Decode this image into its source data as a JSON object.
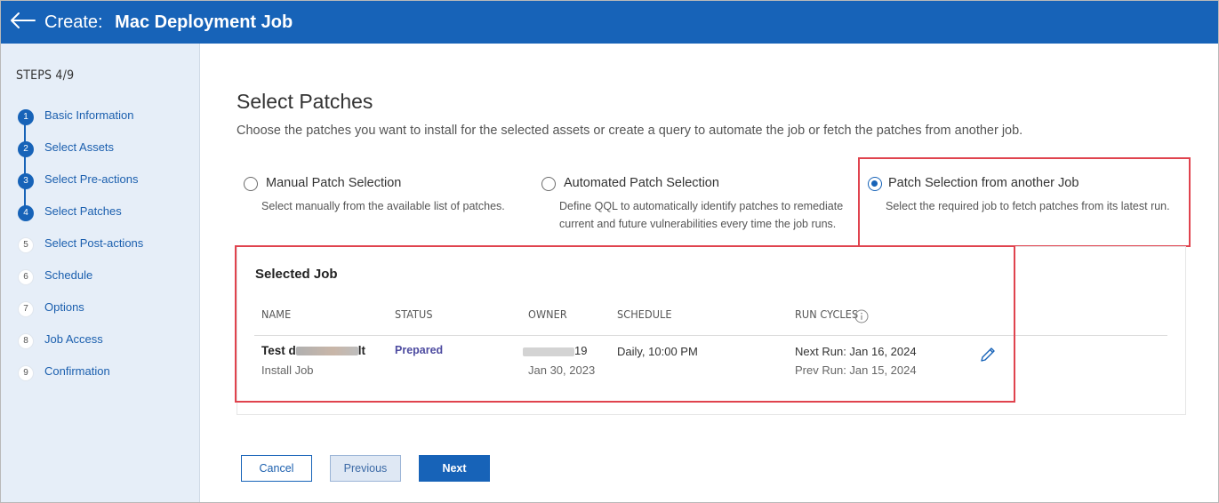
{
  "header": {
    "prefix": "Create:",
    "title": "Mac Deployment Job"
  },
  "sidebar": {
    "steps_label": "STEPS 4/9",
    "items": [
      {
        "num": "1",
        "label": "Basic Information"
      },
      {
        "num": "2",
        "label": "Select Assets"
      },
      {
        "num": "3",
        "label": "Select Pre-actions"
      },
      {
        "num": "4",
        "label": "Select Patches"
      },
      {
        "num": "5",
        "label": "Select Post-actions"
      },
      {
        "num": "6",
        "label": "Schedule"
      },
      {
        "num": "7",
        "label": "Options"
      },
      {
        "num": "8",
        "label": "Job Access"
      },
      {
        "num": "9",
        "label": "Confirmation"
      }
    ]
  },
  "main": {
    "title": "Select Patches",
    "description": "Choose the patches you want to install for the selected assets or create a query to automate the job or fetch the patches from another job.",
    "options": [
      {
        "title": "Manual Patch Selection",
        "desc_lines": [
          "Select manually from the available list of patches."
        ],
        "selected": false
      },
      {
        "title": "Automated Patch Selection",
        "desc_lines": [
          "Define QQL to automatically identify patches to remediate",
          "current and future vulnerabilities every time the job runs."
        ],
        "selected": false
      },
      {
        "title": "Patch Selection from another Job",
        "desc_lines": [
          "Select the required job to fetch patches from its latest run."
        ],
        "selected": true
      }
    ],
    "selected_job": {
      "heading": "Selected Job",
      "columns": {
        "name": "NAME",
        "status": "STATUS",
        "owner": "OWNER",
        "schedule": "SCHEDULE",
        "run_cycles": "RUN CYCLES"
      },
      "row": {
        "name_visible": "Test d",
        "name_tail": "lt",
        "type": "Install Job",
        "status": "Prepared",
        "owner_tail": "19",
        "owner_date": "Jan 30, 2023",
        "schedule": "Daily, 10:00 PM",
        "next_run": "Next Run: Jan 16, 2024",
        "prev_run": "Prev Run: Jan 15, 2024"
      }
    }
  },
  "buttons": {
    "cancel": "Cancel",
    "previous": "Previous",
    "next": "Next"
  },
  "colors": {
    "header_bg": "#1763b8",
    "sidebar_bg": "#e6eef8",
    "highlight": "#e0434e",
    "status": "#4d4ba0"
  },
  "icons": [
    "back-arrow-icon",
    "info-icon",
    "pencil-edit-icon"
  ]
}
